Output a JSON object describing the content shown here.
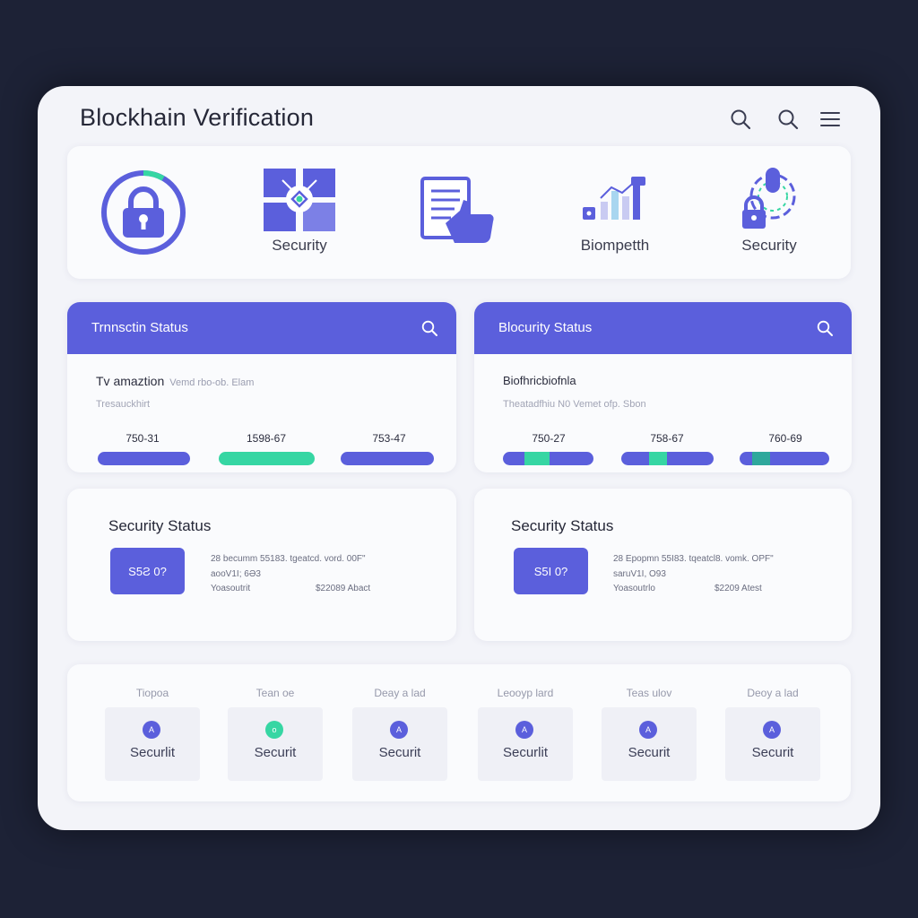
{
  "app": {
    "title": "Blockhain Verification"
  },
  "colors": {
    "accent": "#5b5fdc",
    "success": "#36d6a3",
    "background": "#1d2236",
    "surface": "#f3f4f9"
  },
  "header": {
    "icons": [
      "search-icon",
      "search-icon",
      "menu-icon"
    ]
  },
  "features": [
    {
      "icon": "lock-icon",
      "label": ""
    },
    {
      "icon": "puzzle-shield-icon",
      "label": "Security"
    },
    {
      "icon": "document-thumbs-up-icon",
      "label": ""
    },
    {
      "icon": "bar-chart-icon",
      "label": "Biompetth"
    },
    {
      "icon": "biometric-lock-icon",
      "label": "Security"
    }
  ],
  "cards": [
    {
      "title": "Trnnsctin Status",
      "line1": "Tv amaztion",
      "line1_faint": "Vemd rbo-ob. Elam",
      "line2": "Tresauckhirt",
      "metrics": [
        {
          "label": "750-31",
          "fill": 0,
          "bar": "solid"
        },
        {
          "label": "1598-67",
          "fill": 1,
          "bar": "green"
        },
        {
          "label": "753-47",
          "fill": 0,
          "bar": "solid"
        }
      ]
    },
    {
      "title": "Blocurity Status",
      "line1": "Biofhricbiofnla",
      "line1_faint": "",
      "line2": "Theatadfhiu N0 Vemet ofp. Sbon",
      "metrics": [
        {
          "label": "750-27",
          "fill": 0.25,
          "bar": "segment"
        },
        {
          "label": "758-67",
          "fill": 0.3,
          "bar": "segment"
        },
        {
          "label": "760-69",
          "fill": 0.33,
          "bar": "segment"
        }
      ]
    }
  ],
  "security": [
    {
      "title": "Security Status",
      "button": "S5Ƨ 0?",
      "line1": "28 becumm  55183.   tgeatcd.  vord.  00F\"",
      "line2": "aooV1I; 6Ə3",
      "line3a": "Yoasoutrit",
      "line3b": "$22089 Abact"
    },
    {
      "title": "Security Status",
      "button": "S5I 0?",
      "line1": "28 Epopmn  55I83.   tqeatcl8.  vomk.  OPF\"",
      "line2": "saruV1I, O93",
      "line3a": "Yoasoutrlo",
      "line3b": "$2209 Atest"
    }
  ],
  "tiles": [
    {
      "heading": "Tiopoa",
      "badge": "A",
      "badge_color": "accent",
      "label": "Securlit"
    },
    {
      "heading": "Tean oe",
      "badge": "o",
      "badge_color": "success",
      "label": "Securit"
    },
    {
      "heading": "Deay a lad",
      "badge": "A",
      "badge_color": "accent",
      "label": "Securit"
    },
    {
      "heading": "Leooyp lard",
      "badge": "A",
      "badge_color": "accent",
      "label": "Securlit"
    },
    {
      "heading": "Teas ulov",
      "badge": "A",
      "badge_color": "accent",
      "label": "Securit"
    },
    {
      "heading": "Deoy a lad",
      "badge": "A",
      "badge_color": "accent",
      "label": "Securit"
    }
  ]
}
